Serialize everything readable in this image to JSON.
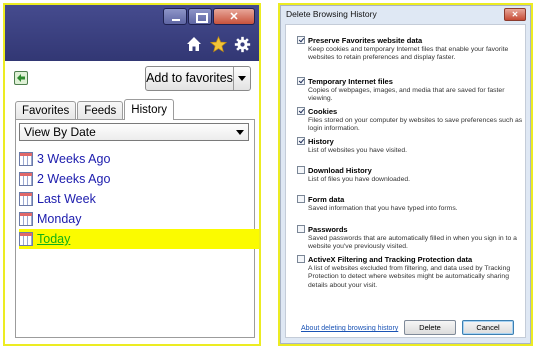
{
  "favorites_center": {
    "add_to_favorites_label": "Add to favorites",
    "tabs": [
      {
        "label": "Favorites"
      },
      {
        "label": "Feeds"
      },
      {
        "label": "History"
      }
    ],
    "active_tab": "History",
    "view_select_value": "View By Date",
    "history_items": [
      {
        "label": "3 Weeks Ago"
      },
      {
        "label": "2 Weeks Ago"
      },
      {
        "label": "Last Week"
      },
      {
        "label": "Monday"
      },
      {
        "label": "Today"
      }
    ],
    "selected_item": "Today",
    "toolbar_icons": [
      "home-icon",
      "star-icon",
      "gear-icon"
    ]
  },
  "delete_dialog": {
    "title": "Delete Browsing History",
    "options": [
      {
        "title": "Preserve Favorites website data",
        "checked": true,
        "description": "Keep cookies and temporary Internet files that enable your favorite websites to retain preferences and display faster."
      },
      {
        "title": "Temporary Internet files",
        "checked": true,
        "description": "Copies of webpages, images, and media that are saved for faster viewing."
      },
      {
        "title": "Cookies",
        "checked": true,
        "description": "Files stored on your computer by websites to save preferences such as login information."
      },
      {
        "title": "History",
        "checked": true,
        "description": "List of websites you have visited."
      },
      {
        "title": "Download History",
        "checked": false,
        "description": "List of files you have downloaded."
      },
      {
        "title": "Form data",
        "checked": false,
        "description": "Saved information that you have typed into forms."
      },
      {
        "title": "Passwords",
        "checked": false,
        "description": "Saved passwords that are automatically filled in when you sign in to a website you've previously visited."
      },
      {
        "title": "ActiveX Filtering and Tracking Protection data",
        "checked": false,
        "description": "A list of websites excluded from filtering, and data used by Tracking Protection to detect where websites might be automatically sharing details about your visit."
      }
    ],
    "about_link": "About deleting browsing history",
    "delete_label": "Delete",
    "cancel_label": "Cancel"
  },
  "colors": {
    "highlight_border": "#ecec22",
    "selected_row": "#fbfb00",
    "link_blue": "#1c1cad",
    "selected_text": "#12b012",
    "titlebar": "#3a3f80"
  }
}
